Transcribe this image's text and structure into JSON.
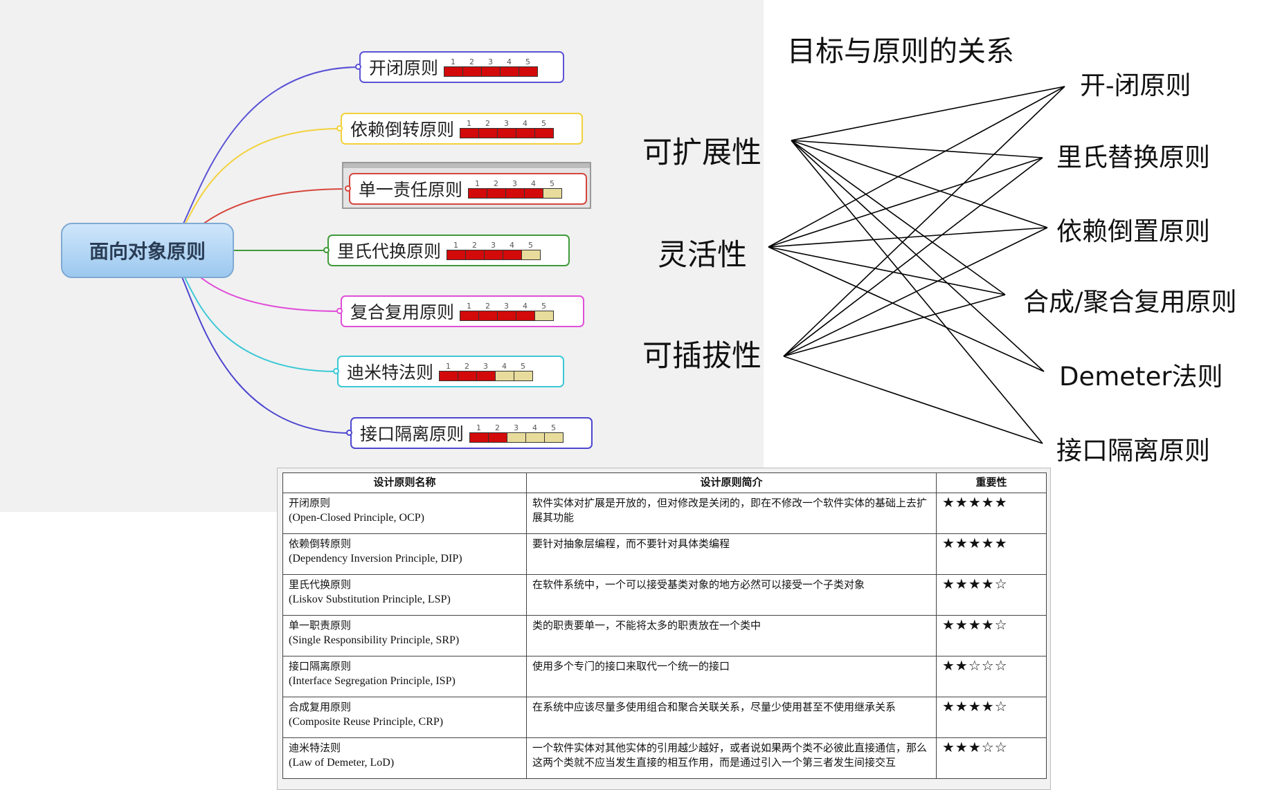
{
  "mindmap": {
    "central": "面向对象原则",
    "scale_labels": [
      "1",
      "2",
      "3",
      "4",
      "5"
    ],
    "colors": {
      "bar_filled": "#d20a0a",
      "bar_empty": "#e8dc9c",
      "central_fill": "#b5d6f5"
    },
    "nodes": [
      {
        "label": "开闭原则",
        "rating": 5,
        "color": "#5b52d6"
      },
      {
        "label": "依赖倒转原则",
        "rating": 5,
        "color": "#f2d13a"
      },
      {
        "label": "单一责任原则",
        "rating": 4,
        "color": "#d6453c"
      },
      {
        "label": "里氏代换原则",
        "rating": 4,
        "color": "#3f9a3a"
      },
      {
        "label": "复合复用原则",
        "rating": 4,
        "color": "#e04ed8"
      },
      {
        "label": "迪米特法则",
        "rating": 3,
        "color": "#3bc8d6"
      },
      {
        "label": "接口隔离原则",
        "rating": 2,
        "color": "#4d46cf"
      }
    ]
  },
  "relation": {
    "title": "目标与原则的关系",
    "goals": [
      "可扩展性",
      "灵活性",
      "可插拔性"
    ],
    "principles": [
      "开-闭原则",
      "里氏替换原则",
      "依赖倒置原则",
      "合成/聚合复用原则",
      "Demeter法则",
      "接口隔离原则"
    ],
    "links": [
      [
        0,
        0
      ],
      [
        0,
        1
      ],
      [
        0,
        2
      ],
      [
        0,
        3
      ],
      [
        0,
        4
      ],
      [
        0,
        5
      ],
      [
        1,
        0
      ],
      [
        1,
        1
      ],
      [
        1,
        2
      ],
      [
        1,
        3
      ],
      [
        1,
        4
      ],
      [
        2,
        0
      ],
      [
        2,
        1
      ],
      [
        2,
        2
      ],
      [
        2,
        3
      ],
      [
        2,
        5
      ]
    ]
  },
  "table": {
    "headers": [
      "设计原则名称",
      "设计原则简介",
      "重要性"
    ],
    "rows": [
      {
        "name": "开闭原则",
        "english": "(Open-Closed Principle, OCP)",
        "desc": "软件实体对扩展是开放的，但对修改是关闭的，即在不修改一个软件实体的基础上去扩展其功能",
        "importance": "★★★★★"
      },
      {
        "name": "依赖倒转原则",
        "english": "(Dependency Inversion Principle, DIP)",
        "desc": "要针对抽象层编程，而不要针对具体类编程",
        "importance": "★★★★★"
      },
      {
        "name": "里氏代换原则",
        "english": "(Liskov Substitution Principle, LSP)",
        "desc": "在软件系统中，一个可以接受基类对象的地方必然可以接受一个子类对象",
        "importance": "★★★★☆"
      },
      {
        "name": "单一职责原则",
        "english": "(Single Responsibility Principle, SRP)",
        "desc": "类的职责要单一，不能将太多的职责放在一个类中",
        "importance": "★★★★☆"
      },
      {
        "name": "接口隔离原则",
        "english": "(Interface Segregation Principle, ISP)",
        "desc": "使用多个专门的接口来取代一个统一的接口",
        "importance": "★★☆☆☆"
      },
      {
        "name": "合成复用原则",
        "english": "(Composite Reuse Principle, CRP)",
        "desc": "在系统中应该尽量多使用组合和聚合关联关系，尽量少使用甚至不使用继承关系",
        "importance": "★★★★☆"
      },
      {
        "name": "迪米特法则",
        "english": "(Law of Demeter, LoD)",
        "desc": "一个软件实体对其他实体的引用越少越好，或者说如果两个类不必彼此直接通信，那么这两个类就不应当发生直接的相互作用，而是通过引入一个第三者发生间接交互",
        "importance": "★★★☆☆"
      }
    ]
  }
}
